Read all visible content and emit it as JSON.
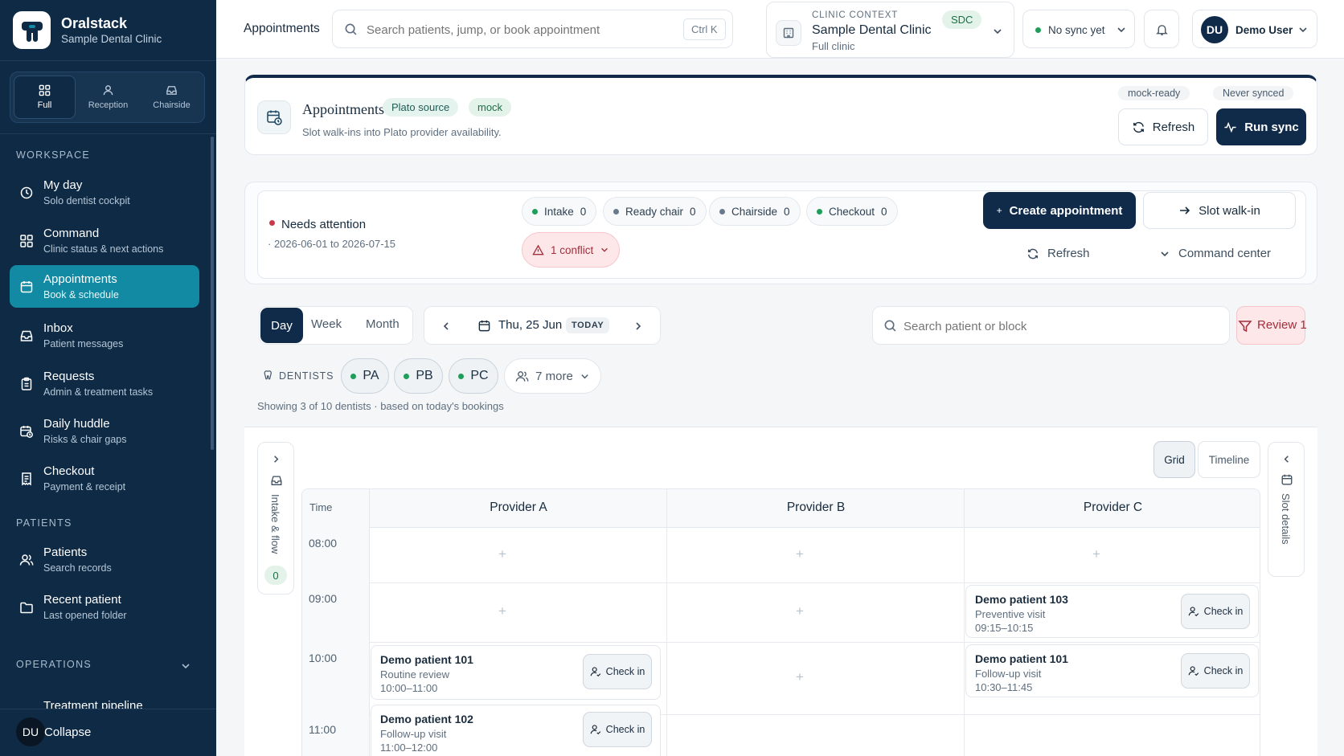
{
  "sidebar": {
    "brand": "Oralstack",
    "clinic": "Sample Dental Clinic",
    "modes": [
      "Full",
      "Reception",
      "Chairside"
    ],
    "sections": {
      "workspace": "WORKSPACE",
      "patients": "PATIENTS",
      "operations": "OPERATIONS"
    },
    "workspace": [
      {
        "title": "My day",
        "sub": "Solo dentist cockpit"
      },
      {
        "title": "Command",
        "sub": "Clinic status & next actions"
      },
      {
        "title": "Appointments",
        "sub": "Book & schedule"
      },
      {
        "title": "Inbox",
        "sub": "Patient messages"
      },
      {
        "title": "Requests",
        "sub": "Admin & treatment tasks"
      },
      {
        "title": "Daily huddle",
        "sub": "Risks & chair gaps"
      },
      {
        "title": "Checkout",
        "sub": "Payment & receipt"
      }
    ],
    "patients": [
      {
        "title": "Patients",
        "sub": "Search records"
      },
      {
        "title": "Recent patient",
        "sub": "Last opened folder"
      }
    ],
    "operations_first": "Treatment pipeline",
    "user_initials": "DU",
    "collapse": "Collapse"
  },
  "topbar": {
    "page": "Appointments",
    "search_placeholder": "Search patients, jump, or book appointment",
    "shortcut": "Ctrl K",
    "context_label": "CLINIC CONTEXT",
    "context_clinic": "Sample Dental Clinic",
    "context_sub": "Full clinic",
    "context_badge": "SDC",
    "sync_status": "No sync yet",
    "user_initials": "DU",
    "user_name": "Demo User"
  },
  "header": {
    "title": "Appointments",
    "badge_source": "Plato source",
    "badge_mock": "mock",
    "subtitle": "Slot walk-ins into Plato provider availability.",
    "status_ready": "mock-ready",
    "status_synced": "Never synced",
    "refresh": "Refresh",
    "run_sync": "Run sync"
  },
  "attention": {
    "title": "Needs attention",
    "range": "· 2026-06-01 to 2026-07-15",
    "stages": [
      {
        "label": "Intake",
        "count": "0"
      },
      {
        "label": "Ready chair",
        "count": "0"
      },
      {
        "label": "Chairside",
        "count": "0"
      },
      {
        "label": "Checkout",
        "count": "0"
      }
    ],
    "conflict": "1 conflict",
    "create": "Create appointment",
    "walkin": "Slot walk-in",
    "refresh": "Refresh",
    "command": "Command center"
  },
  "calendar": {
    "views": [
      "Day",
      "Week",
      "Month"
    ],
    "date": "Thu, 25 Jun",
    "today": "TODAY",
    "search_placeholder": "Search patient or block",
    "review": "Review 1",
    "dentists_label": "DENTISTS",
    "dentists": [
      "PA",
      "PB",
      "PC"
    ],
    "more": "7 more",
    "showing": "Showing 3 of 10 dentists · based on today's bookings",
    "grid_toggle": [
      "Grid",
      "Timeline"
    ],
    "intake_flow": "Intake & flow",
    "intake_count": "0",
    "slot_details": "Slot details",
    "time_header": "Time",
    "providers": [
      "Provider A",
      "Provider B",
      "Provider C"
    ],
    "times": [
      "08:00",
      "09:00",
      "10:00",
      "11:00"
    ],
    "appointments": [
      {
        "name": "Demo patient 103",
        "type": "Preventive visit",
        "time": "09:15–10:15",
        "action": "Check in"
      },
      {
        "name": "Demo patient 101",
        "type": "Routine review",
        "time": "10:00–11:00",
        "action": "Check in"
      },
      {
        "name": "Demo patient 101",
        "type": "Follow-up visit",
        "time": "10:30–11:45",
        "action": "Check in"
      },
      {
        "name": "Demo patient 102",
        "type": "Follow-up visit",
        "time": "11:00–12:00",
        "action": "Check in"
      }
    ]
  },
  "colors": {
    "sidebar": "#0e2a45",
    "accent": "#138aa3",
    "primary": "#0f2b49",
    "success": "#1f9d5a",
    "danger": "#c9394a"
  }
}
